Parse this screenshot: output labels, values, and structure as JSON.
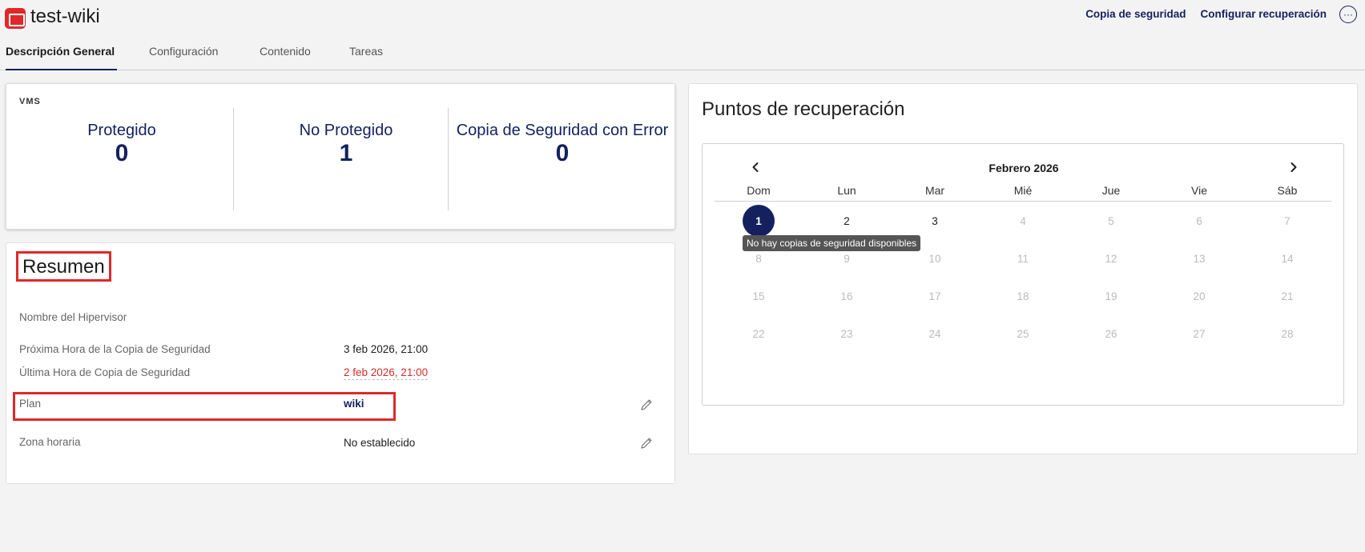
{
  "header": {
    "app_title": "test-wiki",
    "actions": [
      "Copia de seguridad",
      "Configurar recuperación"
    ],
    "more_glyph": "···",
    "more_icon": "more-horizontal-icon"
  },
  "tabs": [
    {
      "label": "Descripción General",
      "active": true
    },
    {
      "label": "Configuración",
      "active": false
    },
    {
      "label": "Contenido",
      "active": false
    },
    {
      "label": "Tareas",
      "active": false
    }
  ],
  "vms": {
    "label": "VMS",
    "stats": [
      {
        "title": "Protegido",
        "value": "0"
      },
      {
        "title": "No Protegido",
        "value": "1"
      },
      {
        "title": "Copia de Seguridad con Error",
        "value": "0"
      }
    ]
  },
  "summary": {
    "title": "Resumen",
    "rows": [
      {
        "label": "Nombre del Hipervisor",
        "value": ""
      },
      {
        "label": "Próxima Hora de la Copia de Seguridad",
        "value": "3 feb 2026, 21:00"
      },
      {
        "label": "Última Hora de Copia de Seguridad",
        "value": "2 feb 2026, 21:00"
      },
      {
        "label": "Plan",
        "value": "wiki"
      },
      {
        "label": "Zona horaria",
        "value": "No establecido"
      }
    ]
  },
  "recovery_points": {
    "title": "Puntos de recuperación",
    "month": "Febrero 2026",
    "weekdays": [
      "Dom",
      "Lun",
      "Mar",
      "Mié",
      "Jue",
      "Vie",
      "Sáb"
    ],
    "selected_day": 1,
    "available_days": [
      1,
      2,
      3
    ],
    "days_in_month": 28,
    "first_weekday": 0,
    "tooltip": "No hay copias de seguridad disponibles"
  },
  "colors": {
    "accent": "#14215e",
    "highlight": "#e0282b",
    "error_text": "#d32b2b"
  }
}
